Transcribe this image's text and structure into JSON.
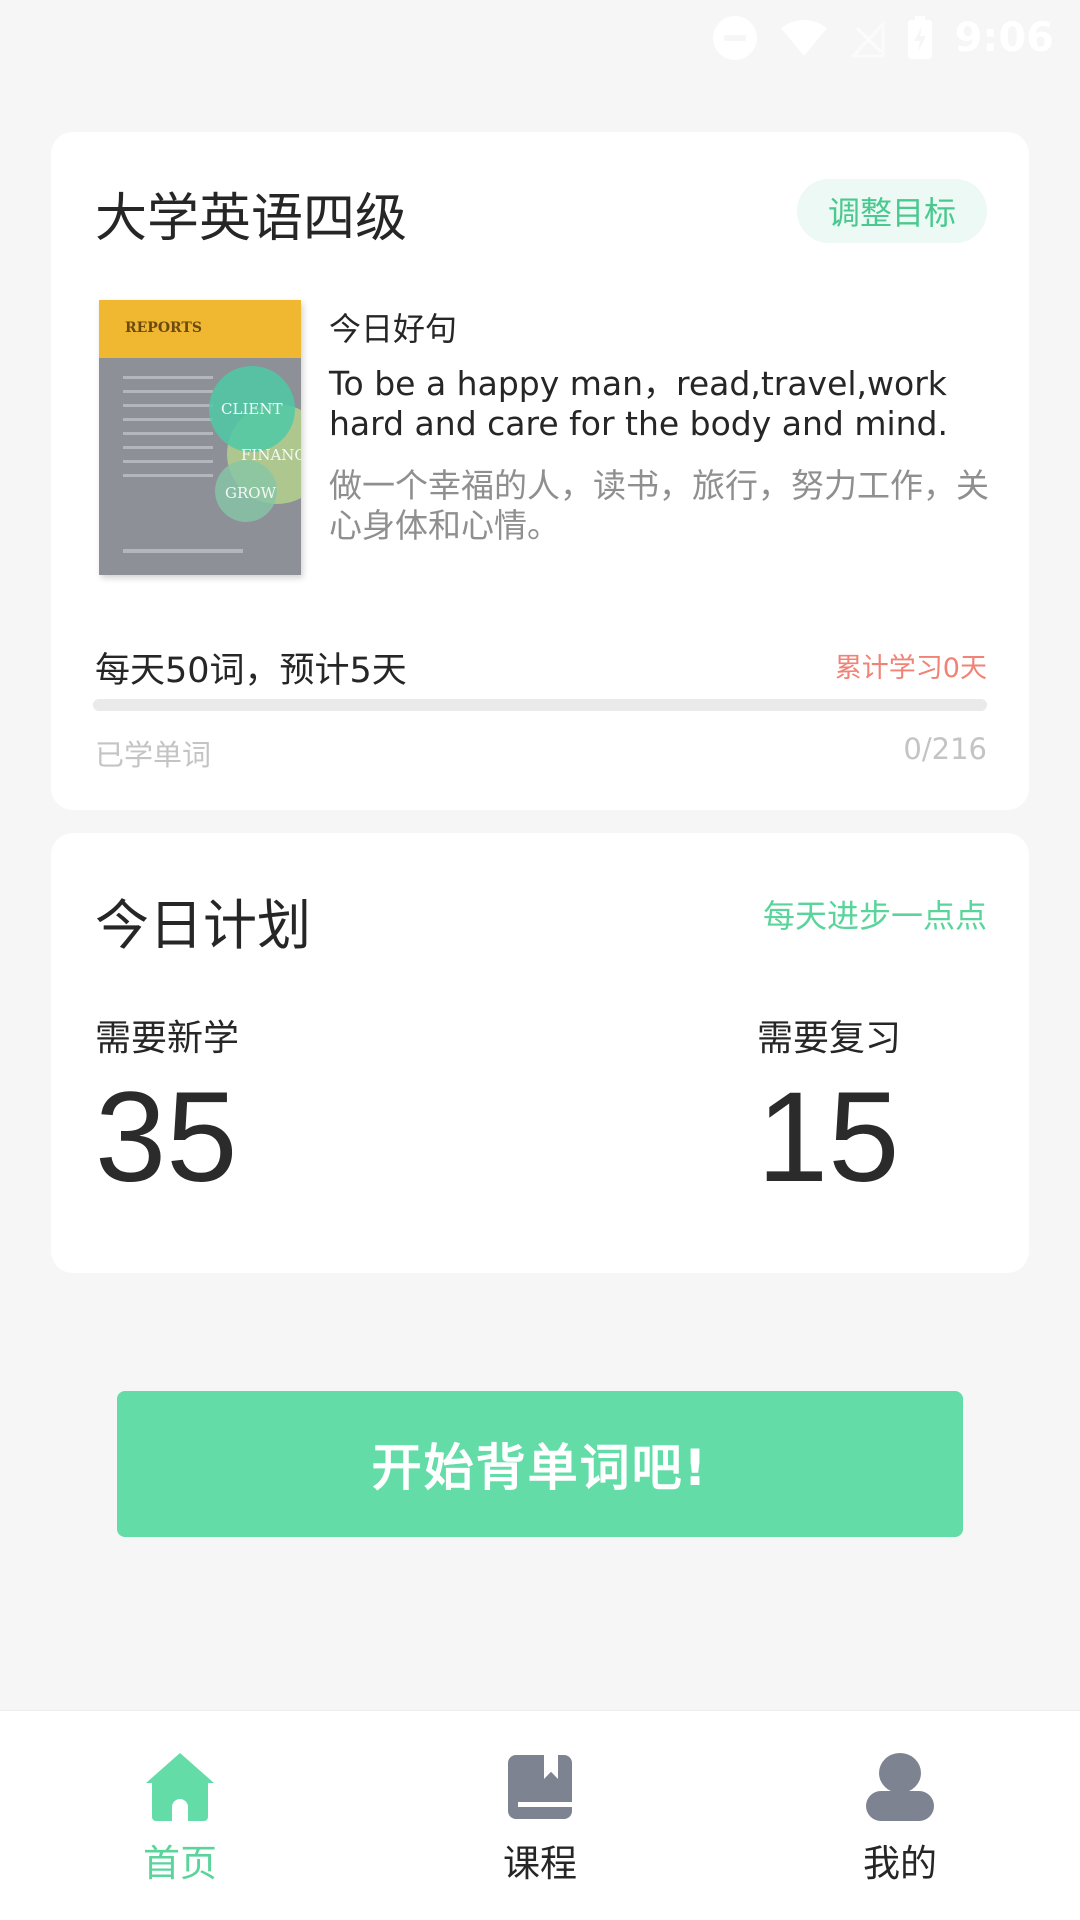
{
  "status_bar": {
    "time": "9:06",
    "icons": [
      "do-not-disturb-icon",
      "wifi-icon",
      "no-signal-icon",
      "battery-charging-icon"
    ]
  },
  "goal_card": {
    "title": "大学英语四级",
    "adjust_button": "调整目标",
    "book_cover": {
      "brand": "REPORTS",
      "labels": [
        "CLIENT",
        "FINANCE",
        "GROW"
      ]
    },
    "quote_label": "今日好句",
    "quote_en": "To be a happy man，read,travel,work hard and care for the body and mind.",
    "quote_cn": "做一个幸福的人，读书，旅行，努力工作，关心身体和心情。",
    "daily_goal": "每天50词，预计5天",
    "study_days": "累计学习0天",
    "progress_fraction": 0.0,
    "learned_label": "已学单词",
    "learned_count": "0/216"
  },
  "plan_card": {
    "title": "今日计划",
    "slogan": "每天进步一点点",
    "new_label": "需要新学",
    "new_count": "35",
    "review_label": "需要复习",
    "review_count": "15"
  },
  "start_button": "开始背单词吧!",
  "bottom_nav": {
    "items": [
      {
        "label": "首页",
        "icon": "home-icon",
        "active": true
      },
      {
        "label": "课程",
        "icon": "book-icon",
        "active": false
      },
      {
        "label": "我的",
        "icon": "user-icon",
        "active": false
      }
    ]
  },
  "colors": {
    "accent": "#63dca8",
    "accent_text": "#5bd49b",
    "warning_text": "#f08276",
    "background": "#f6f6f6"
  }
}
